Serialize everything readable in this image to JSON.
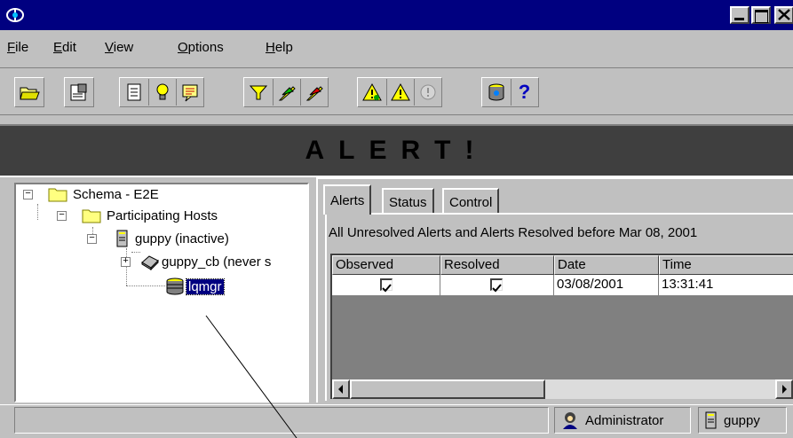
{
  "window": {
    "colors": {
      "titlebar": "#000080",
      "banner": "#3f3f3f",
      "selection": "#000080"
    },
    "icons": [
      "app-icon",
      "minimize-icon",
      "maximize-icon",
      "close-icon"
    ]
  },
  "menu": [
    {
      "label": "File",
      "underline": "F",
      "rest": "ile"
    },
    {
      "label": "Edit",
      "underline": "E",
      "rest": "dit"
    },
    {
      "label": "View",
      "underline": "V",
      "rest": "iew"
    },
    {
      "label": "Options",
      "underline": "O",
      "rest": "ptions"
    },
    {
      "label": "Help",
      "underline": "H",
      "rest": "elp"
    }
  ],
  "toolbar": {
    "icons": [
      "open-folder-icon",
      "properties-icon",
      "list-icon",
      "lightbulb-icon",
      "notes-icon",
      "filter-icon",
      "alarm-on-icon",
      "alarm-off-icon",
      "warning-icon",
      "warning-icon",
      "warning-disabled-icon",
      "database-icon"
    ],
    "help_label": "?"
  },
  "banner": {
    "text": "ALERT!"
  },
  "tree": {
    "root": "Schema - E2E",
    "hosts": "Participating Hosts",
    "host": "guppy (inactive)",
    "cb": "guppy_cb (never s",
    "selected": "lqmgr"
  },
  "tabs": {
    "alerts": "Alerts",
    "status": "Status",
    "control": "Control"
  },
  "alerts": {
    "summary": "All Unresolved Alerts and Alerts Resolved before Mar 08, 2001",
    "columns": [
      "Observed",
      "Resolved",
      "Date",
      "Time"
    ],
    "row": {
      "observed": true,
      "resolved": true,
      "date": "03/08/2001",
      "time": "13:31:41"
    }
  },
  "statusbar": {
    "user": "Administrator",
    "host": "guppy"
  }
}
